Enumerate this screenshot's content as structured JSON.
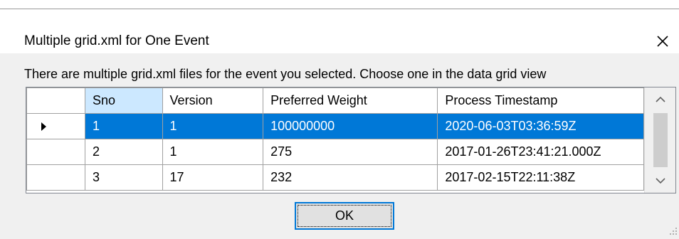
{
  "dialog": {
    "title": "Multiple grid.xml for One Event",
    "close_icon": "close-icon",
    "instruction": "There are multiple grid.xml files for the event you selected. Choose one in the data grid view"
  },
  "grid": {
    "columns": [
      "Sno",
      "Version",
      "Preferred Weight",
      "Process Timestamp"
    ],
    "rows": [
      {
        "sno": "1",
        "version": "1",
        "weight": "100000000",
        "timestamp": "2020-06-03T03:36:59Z",
        "selected": true
      },
      {
        "sno": "2",
        "version": "1",
        "weight": "275",
        "timestamp": "2017-01-26T23:41:21.000Z",
        "selected": false
      },
      {
        "sno": "3",
        "version": "17",
        "weight": "232",
        "timestamp": "2017-02-15T22:11:38Z",
        "selected": false
      }
    ],
    "current_row_icon": "triangle-right-icon",
    "scroll_up_icon": "chevron-up-icon",
    "scroll_down_icon": "chevron-down-icon"
  },
  "buttons": {
    "ok_label": "OK"
  },
  "colors": {
    "selection": "#0078d7",
    "header_selected": "#cce8ff",
    "button_border": "#0078d7"
  }
}
